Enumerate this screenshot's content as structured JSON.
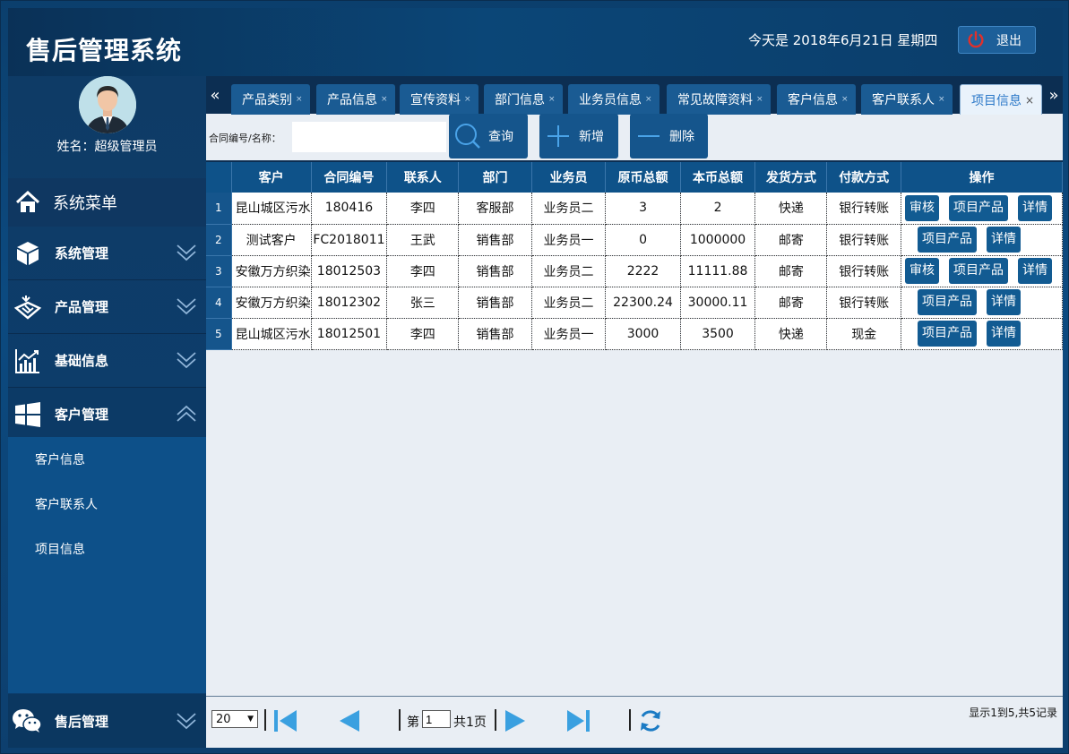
{
  "header": {
    "title": "售后管理系统",
    "date": "今天是 2018年6月21日 星期四",
    "logout_label": "退出"
  },
  "sidebar": {
    "user_name": "姓名：超级管理员",
    "menu_title": "系统菜单",
    "groups": [
      {
        "label": "系统管理",
        "icon": "cube-icon"
      },
      {
        "label": "产品管理",
        "icon": "product-icon"
      },
      {
        "label": "基础信息",
        "icon": "chart-icon"
      },
      {
        "label": "客户管理",
        "icon": "windows-icon"
      }
    ],
    "sub_items": [
      "客户信息",
      "客户联系人",
      "项目信息"
    ],
    "bottom_group": {
      "label": "售后管理",
      "icon": "wechat-icon"
    }
  },
  "tabs": [
    {
      "label": "产品类别"
    },
    {
      "label": "产品信息"
    },
    {
      "label": "宣传资料"
    },
    {
      "label": "部门信息"
    },
    {
      "label": "业务员信息"
    },
    {
      "label": "常见故障资料"
    },
    {
      "label": "客户信息"
    },
    {
      "label": "客户联系人"
    },
    {
      "label": "项目信息",
      "active": true
    }
  ],
  "toolbar": {
    "search_label": "合同编号/名称：",
    "search_value": "",
    "query_label": "查询",
    "add_label": "新增",
    "delete_label": "删除"
  },
  "table": {
    "columns": [
      "客户",
      "合同编号",
      "联系人",
      "部门",
      "业务员",
      "原币总额",
      "本币总额",
      "发货方式",
      "付款方式",
      "操作"
    ],
    "rows": [
      {
        "n": "1",
        "customer": "昆山城区污水",
        "contract": "180416",
        "contact": "李四",
        "dept": "客服部",
        "sales": "业务员二",
        "orig": "3",
        "local": "2",
        "ship": "快递",
        "pay": "银行转账",
        "ops": [
          "审核",
          "项目产品",
          "详情"
        ]
      },
      {
        "n": "2",
        "customer": "测试客户",
        "contract": "FC2018011",
        "contact": "王武",
        "dept": "销售部",
        "sales": "业务员一",
        "orig": "0",
        "local": "1000000",
        "ship": "邮寄",
        "pay": "银行转账",
        "ops": [
          "项目产品",
          "详情"
        ]
      },
      {
        "n": "3",
        "customer": "安徽万方织染",
        "contract": "18012503",
        "contact": "李四",
        "dept": "销售部",
        "sales": "业务员二",
        "orig": "2222",
        "local": "11111.88",
        "ship": "邮寄",
        "pay": "银行转账",
        "ops": [
          "审核",
          "项目产品",
          "详情"
        ]
      },
      {
        "n": "4",
        "customer": "安徽万方织染",
        "contract": "18012302",
        "contact": "张三",
        "dept": "销售部",
        "sales": "业务员二",
        "orig": "22300.24",
        "local": "30000.11",
        "ship": "邮寄",
        "pay": "银行转账",
        "ops": [
          "项目产品",
          "详情"
        ]
      },
      {
        "n": "5",
        "customer": "昆山城区污水",
        "contract": "18012501",
        "contact": "李四",
        "dept": "销售部",
        "sales": "业务员一",
        "orig": "3000",
        "local": "3500",
        "ship": "快递",
        "pay": "现金",
        "ops": [
          "项目产品",
          "详情"
        ]
      }
    ]
  },
  "pager": {
    "page_size": "20",
    "page_prefix": "第",
    "page_value": "1",
    "page_total": "共1页",
    "info": "显示1到5,共5记录"
  },
  "colors": {
    "accent": "#15558c",
    "header_bg": "#0b4677",
    "active_tab_text": "#2b78c8"
  }
}
